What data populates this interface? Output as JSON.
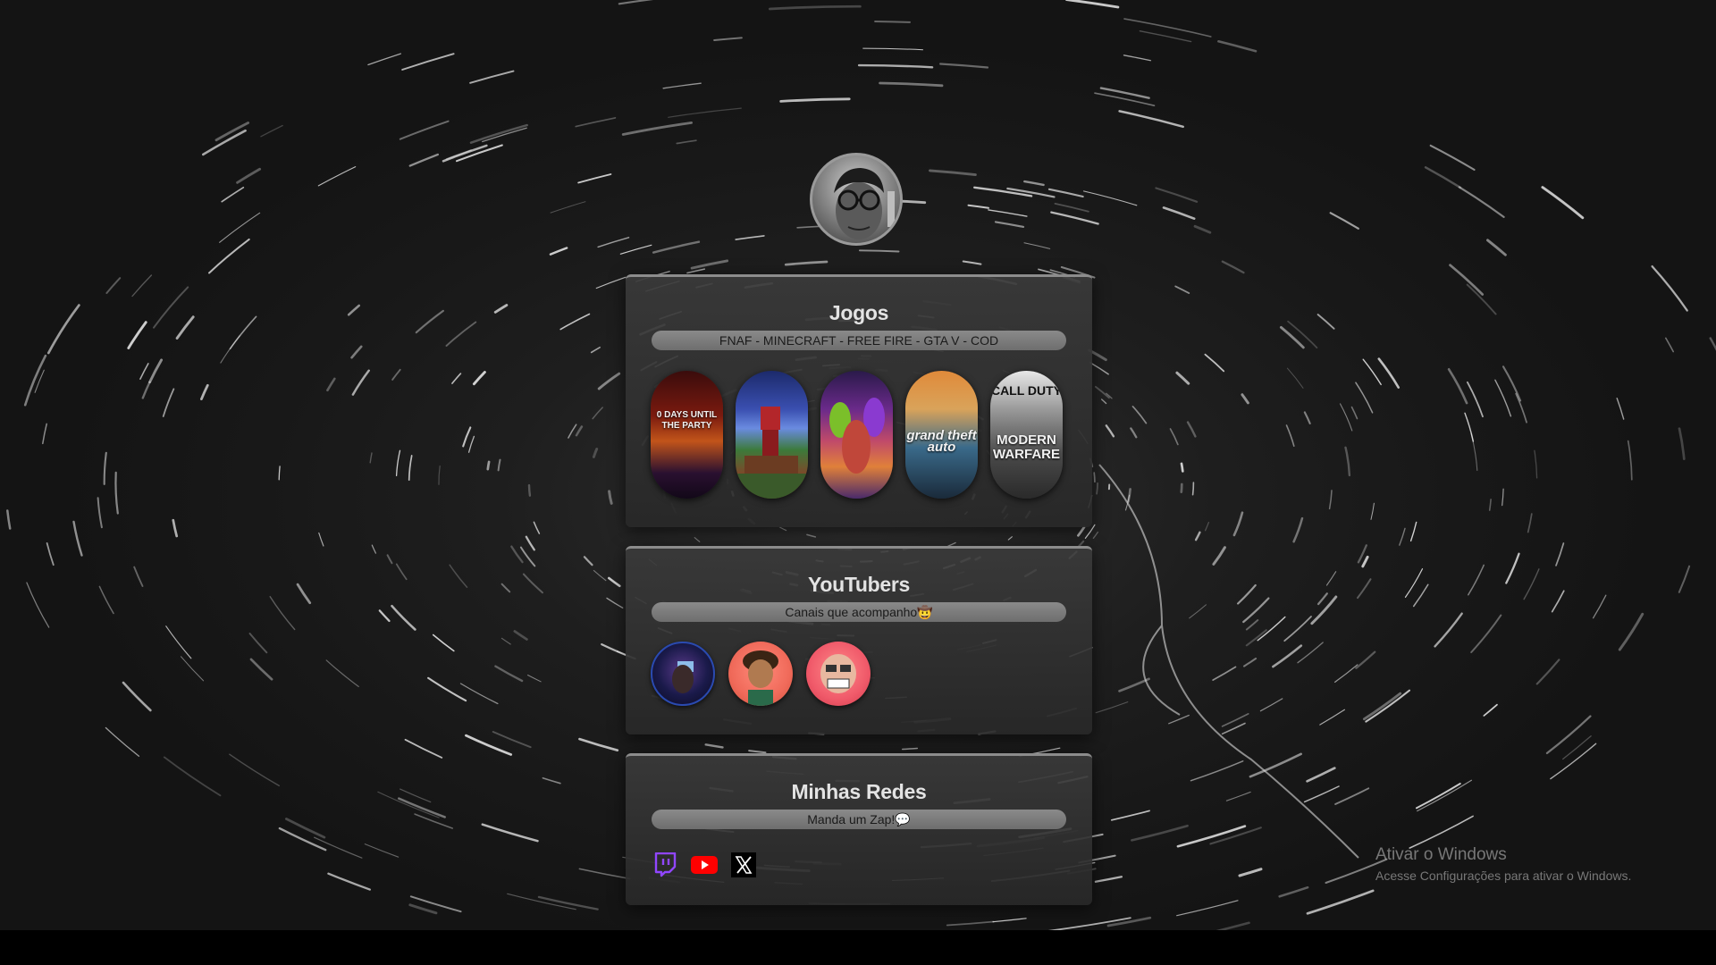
{
  "profile": {
    "avatar_icon": "profile-photo"
  },
  "games": {
    "title": "Jogos",
    "subtitle": "FNAF - MINECRAFT - FREE FIRE - GTA V - COD",
    "covers": [
      {
        "name": "fnaf",
        "caption": "0 DAYS UNTIL THE PARTY"
      },
      {
        "name": "minecraft",
        "caption": ""
      },
      {
        "name": "free-fire",
        "caption": ""
      },
      {
        "name": "gta-v",
        "caption": "grand theft auto"
      },
      {
        "name": "cod",
        "caption_top": "CALL DUTY",
        "caption": "MODERN WARFARE"
      }
    ]
  },
  "youtubers": {
    "title": "YouTubers",
    "subtitle": "Canais que acompanho🤠",
    "channels": [
      "channel-1",
      "channel-2",
      "channel-3"
    ]
  },
  "social": {
    "title": "Minhas Redes",
    "subtitle": "Manda um Zap!💬",
    "links": [
      "twitch-icon",
      "youtube-icon",
      "x-icon"
    ]
  },
  "watermark": {
    "line1": "Ativar o Windows",
    "line2": "Acesse Configurações para ativar o Windows."
  },
  "colors": {
    "twitch": "#9146ff",
    "youtube": "#ff0000",
    "x": "#ffffff",
    "pill": "#7c7c7c"
  }
}
